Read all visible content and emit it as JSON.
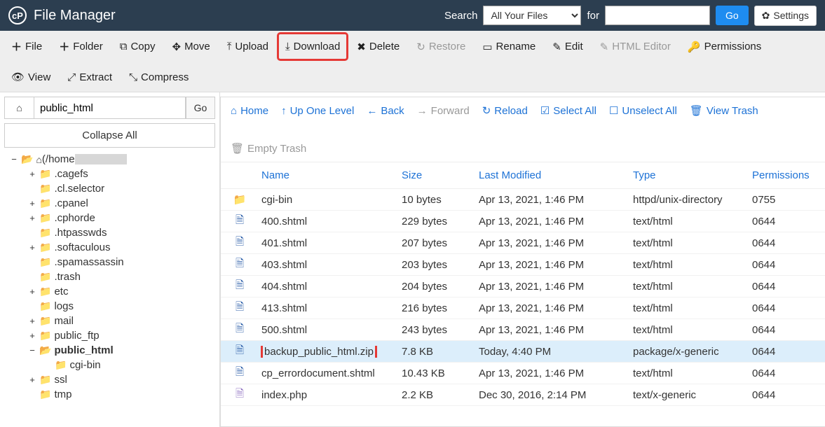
{
  "header": {
    "app_title": "File Manager",
    "search_label": "Search",
    "search_select": "All Your Files",
    "for_label": "for",
    "go_label": "Go",
    "settings_label": "Settings"
  },
  "toolbar": {
    "file": "File",
    "folder": "Folder",
    "copy": "Copy",
    "move": "Move",
    "upload": "Upload",
    "download": "Download",
    "delete": "Delete",
    "restore": "Restore",
    "rename": "Rename",
    "edit": "Edit",
    "html_editor": "HTML Editor",
    "permissions": "Permissions",
    "view": "View",
    "extract": "Extract",
    "compress": "Compress"
  },
  "sidebar": {
    "path_value": "public_html",
    "go_label": "Go",
    "collapse_all": "Collapse All",
    "root_label": "(/home",
    "nodes": [
      {
        "toggle": "+",
        "label": ".cagefs"
      },
      {
        "toggle": "",
        "label": ".cl.selector"
      },
      {
        "toggle": "+",
        "label": ".cpanel"
      },
      {
        "toggle": "+",
        "label": ".cphorde"
      },
      {
        "toggle": "",
        "label": ".htpasswds"
      },
      {
        "toggle": "+",
        "label": ".softaculous"
      },
      {
        "toggle": "",
        "label": ".spamassassin"
      },
      {
        "toggle": "",
        "label": ".trash"
      },
      {
        "toggle": "+",
        "label": "etc"
      },
      {
        "toggle": "",
        "label": "logs"
      },
      {
        "toggle": "+",
        "label": "mail"
      },
      {
        "toggle": "+",
        "label": "public_ftp"
      },
      {
        "toggle": "−",
        "label": "public_html",
        "bold": true,
        "open": true
      },
      {
        "toggle": "",
        "label": "cgi-bin",
        "indent": true
      },
      {
        "toggle": "+",
        "label": "ssl"
      },
      {
        "toggle": "",
        "label": "tmp"
      }
    ]
  },
  "nav": {
    "home": "Home",
    "up": "Up One Level",
    "back": "Back",
    "forward": "Forward",
    "reload": "Reload",
    "select_all": "Select All",
    "unselect_all": "Unselect All",
    "view_trash": "View Trash",
    "empty_trash": "Empty Trash"
  },
  "table": {
    "headers": {
      "name": "Name",
      "size": "Size",
      "last_modified": "Last Modified",
      "type": "Type",
      "permissions": "Permissions"
    },
    "rows": [
      {
        "icon": "folder",
        "name": "cgi-bin",
        "size": "10 bytes",
        "modified": "Apr 13, 2021, 1:46 PM",
        "type": "httpd/unix-directory",
        "perm": "0755"
      },
      {
        "icon": "file",
        "name": "400.shtml",
        "size": "229 bytes",
        "modified": "Apr 13, 2021, 1:46 PM",
        "type": "text/html",
        "perm": "0644"
      },
      {
        "icon": "file",
        "name": "401.shtml",
        "size": "207 bytes",
        "modified": "Apr 13, 2021, 1:46 PM",
        "type": "text/html",
        "perm": "0644"
      },
      {
        "icon": "file",
        "name": "403.shtml",
        "size": "203 bytes",
        "modified": "Apr 13, 2021, 1:46 PM",
        "type": "text/html",
        "perm": "0644"
      },
      {
        "icon": "file",
        "name": "404.shtml",
        "size": "204 bytes",
        "modified": "Apr 13, 2021, 1:46 PM",
        "type": "text/html",
        "perm": "0644"
      },
      {
        "icon": "file",
        "name": "413.shtml",
        "size": "216 bytes",
        "modified": "Apr 13, 2021, 1:46 PM",
        "type": "text/html",
        "perm": "0644"
      },
      {
        "icon": "file",
        "name": "500.shtml",
        "size": "243 bytes",
        "modified": "Apr 13, 2021, 1:46 PM",
        "type": "text/html",
        "perm": "0644"
      },
      {
        "icon": "zip",
        "name": "backup_public_html.zip",
        "size": "7.8 KB",
        "modified": "Today, 4:40 PM",
        "type": "package/x-generic",
        "perm": "0644",
        "selected": true,
        "highlight_name": true
      },
      {
        "icon": "file",
        "name": "cp_errordocument.shtml",
        "size": "10.43 KB",
        "modified": "Apr 13, 2021, 1:46 PM",
        "type": "text/html",
        "perm": "0644"
      },
      {
        "icon": "php",
        "name": "index.php",
        "size": "2.2 KB",
        "modified": "Dec 30, 2016, 2:14 PM",
        "type": "text/x-generic",
        "perm": "0644"
      }
    ]
  }
}
